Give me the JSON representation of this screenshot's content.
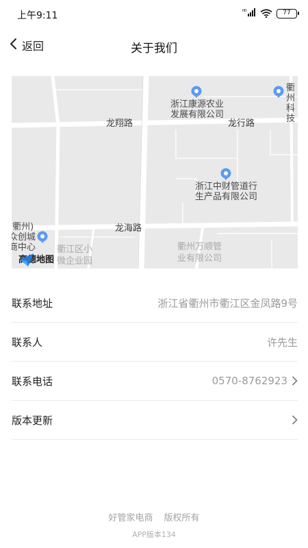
{
  "status_bar": {
    "time": "上午9:11",
    "signal": "HD",
    "battery": "77"
  },
  "header": {
    "back_label": "返回",
    "title": "关于我们"
  },
  "map": {
    "pois": [
      {
        "name": "浙江康源农业\n发展有限公司"
      },
      {
        "name": "浙江中财管道行\n生产品有限公司"
      },
      {
        "name": "衢州\n科技"
      },
      {
        "name": "(衢州)\n众创城\n商中心"
      }
    ],
    "roads": [
      "龙翔路",
      "龙行路",
      "龙海路"
    ],
    "faint_labels": [
      "衢江区小\n微企业园",
      "衢州万顺管\n业有限公司"
    ],
    "logo": "高德地图"
  },
  "info": {
    "address_label": "联系地址",
    "address_value": "浙江省衢州市衢江区金凤路9号",
    "contact_label": "联系人",
    "contact_value": "许先生",
    "phone_label": "联系电话",
    "phone_value": "0570-8762923",
    "update_label": "版本更新"
  },
  "footer": {
    "company": "好管家电商",
    "rights": "版权所有",
    "version": "APP版本134"
  },
  "colors": {
    "map_bg": "#e9e9ea",
    "road": "#ffffff",
    "poi_pin": "#5b9bf1"
  }
}
